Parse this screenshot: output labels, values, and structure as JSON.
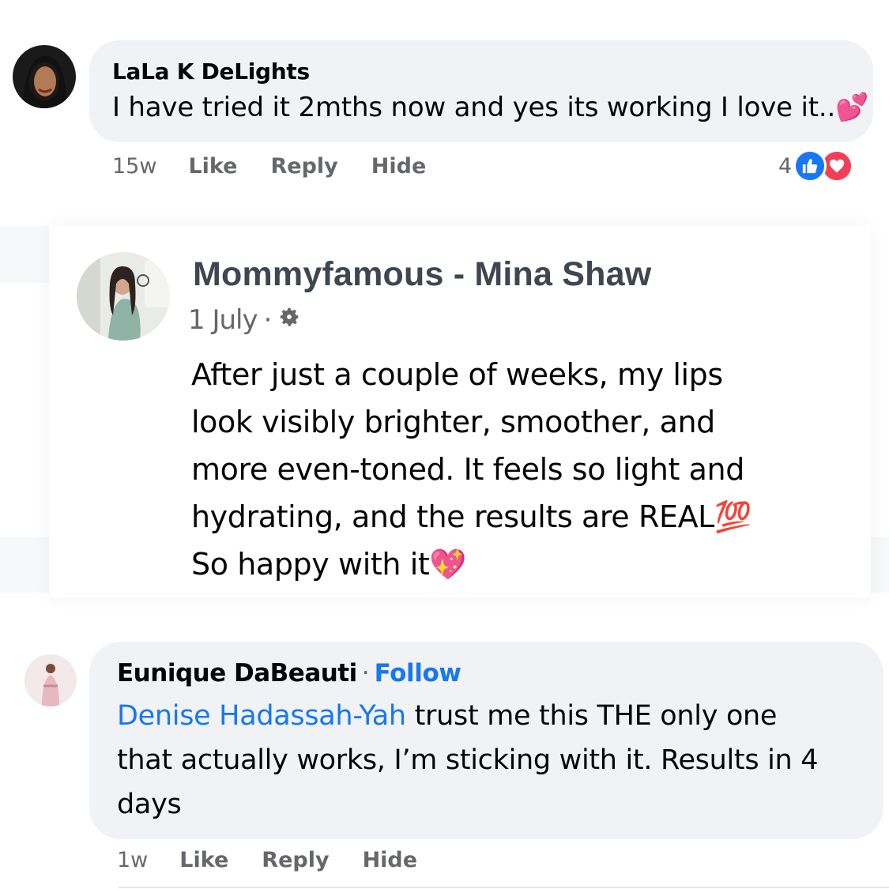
{
  "comment1": {
    "author": "LaLa K DeLights",
    "text": "I have tried it 2mths now and yes its working I love it..",
    "emoji": "💕",
    "time": "15w",
    "actions": [
      "Like",
      "Reply",
      "Hide"
    ],
    "reaction_count": "4",
    "reactions": [
      "like-icon",
      "love-icon"
    ]
  },
  "post": {
    "author": "Mommyfamous - Mina Shaw",
    "date": "1 July",
    "separator": "·",
    "audience_icon": "gear-icon",
    "body_lines": [
      "After just a couple of weeks, my lips",
      "look visibly brighter, smoother, and",
      "more even-toned. It feels so light and",
      "hydrating, and the results are REAL"
    ],
    "emoji_100": "💯",
    "last_line": "So happy with it",
    "emoji_heart": "💖"
  },
  "comment3": {
    "author": "Eunique DaBeauti",
    "separator": "·",
    "follow_label": "Follow",
    "mention": "Denise Hadassah-Yah",
    "text_line1": " trust me this THE only one",
    "text_line2": "that actually works, I’m sticking with it. Results in 4",
    "text_line3": "days",
    "time": "1w",
    "actions": [
      "Like",
      "Reply",
      "Hide"
    ]
  },
  "colors": {
    "bubble": "#f0f2f5",
    "link": "#1877f2",
    "meta": "#65676b",
    "like": "#1877f2",
    "love": "#f33e58"
  }
}
